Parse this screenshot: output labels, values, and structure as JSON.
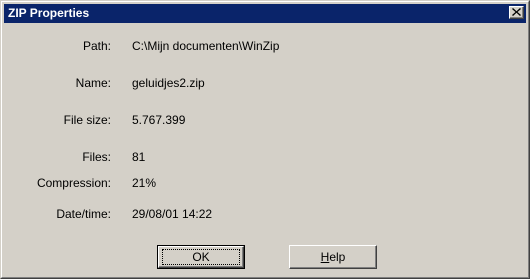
{
  "dialog": {
    "title": "ZIP Properties",
    "close_icon": "close-icon"
  },
  "properties": [
    {
      "label": "Path:",
      "value": "C:\\Mijn documenten\\WinZip"
    },
    {
      "label": "Name:",
      "value": "geluidjes2.zip"
    },
    {
      "label": "File size:",
      "value": "5.767.399"
    },
    {
      "label": "Files:",
      "value": "81"
    },
    {
      "label": "Compression:",
      "value": "21%"
    },
    {
      "label": "Date/time:",
      "value": "29/08/01  14:22"
    }
  ],
  "buttons": {
    "ok_label": "OK",
    "help_mnemonic": "H",
    "help_rest": "elp"
  },
  "colors": {
    "titlebar": "#0a246a",
    "dialog_face": "#d4d0c8",
    "title_text": "#ffffff"
  }
}
